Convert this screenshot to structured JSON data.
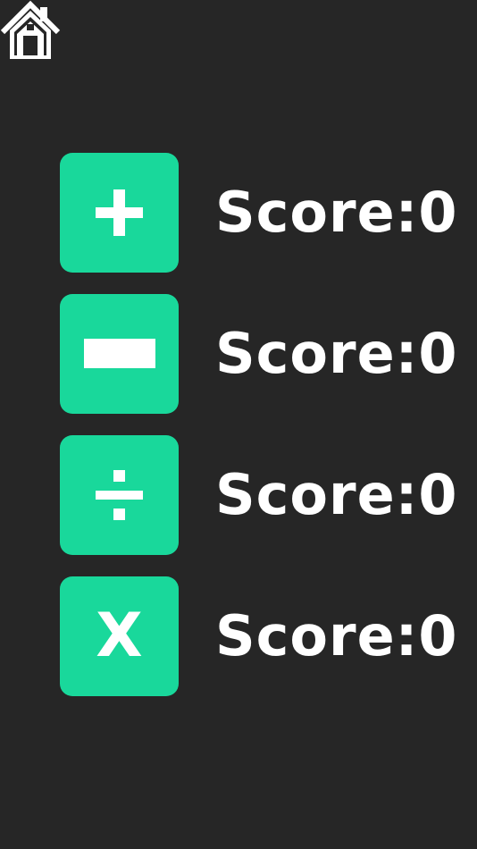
{
  "home": {
    "icon": "home-icon"
  },
  "colors": {
    "background": "#262626",
    "button": "#19d89b",
    "text": "#ffffff"
  },
  "rows": [
    {
      "operation": "addition",
      "icon": "plus-icon",
      "score_label": "Score:0"
    },
    {
      "operation": "subtraction",
      "icon": "minus-icon",
      "score_label": "Score:0"
    },
    {
      "operation": "division",
      "icon": "divide-icon",
      "score_label": "Score:0"
    },
    {
      "operation": "multiplication",
      "symbol": "X",
      "score_label": "Score:0"
    }
  ]
}
